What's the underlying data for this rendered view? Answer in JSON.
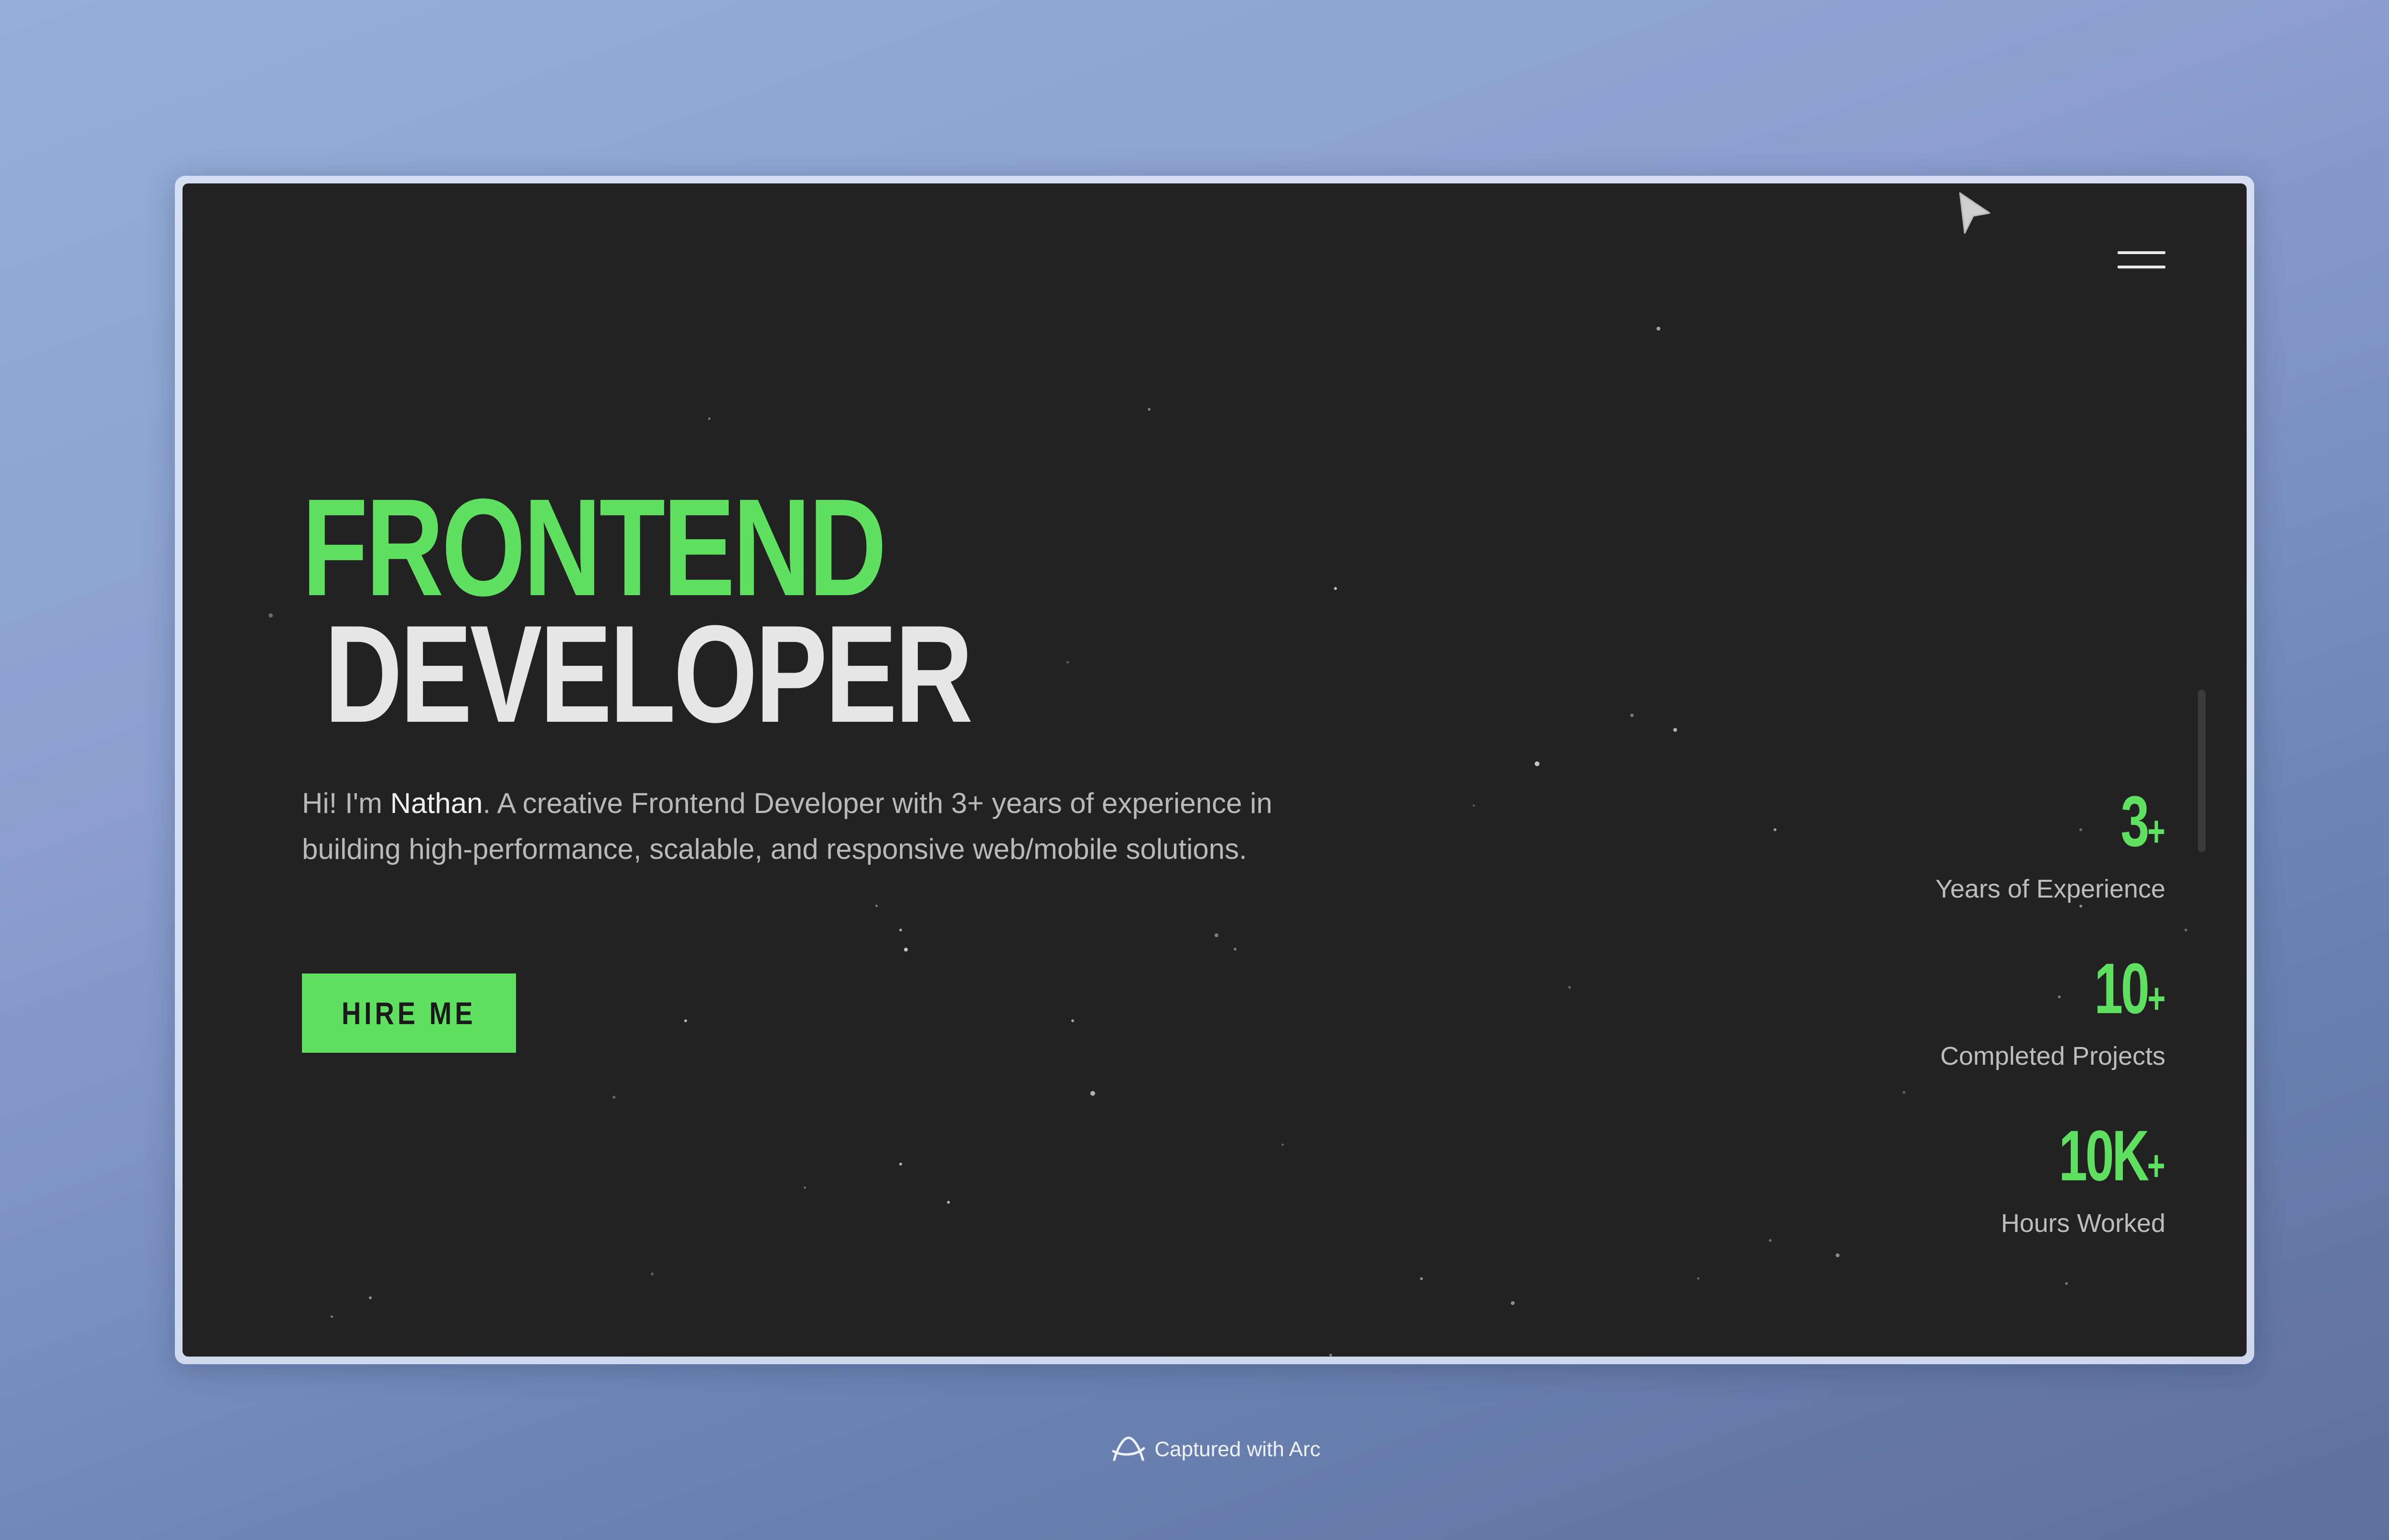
{
  "hero": {
    "title_line1": "FRONTEND",
    "title_line2": "DEVELOPER",
    "intro_prefix": "Hi! I'm ",
    "intro_name": "Nathan",
    "intro_suffix": ". A creative Frontend Developer with 3+ years of experience in building high-performance, scalable, and responsive web/mobile solutions.",
    "cta_label": "HIRE ME"
  },
  "stats": [
    {
      "value": "3",
      "suffix": "+",
      "label": "Years of Experience"
    },
    {
      "value": "10",
      "suffix": "+",
      "label": "Completed Projects"
    },
    {
      "value": "10K",
      "suffix": "+",
      "label": "Hours Worked"
    }
  ],
  "footer": {
    "text": "Captured with Arc"
  },
  "icons": {
    "menu": "hamburger-menu-icon",
    "cursor": "cursor-icon",
    "arc": "arc-logo-icon"
  },
  "colors": {
    "accent": "#5fe060",
    "page_background": "#222222",
    "heading_secondary": "#e6e6e6",
    "body_text": "#b9b9b9"
  }
}
